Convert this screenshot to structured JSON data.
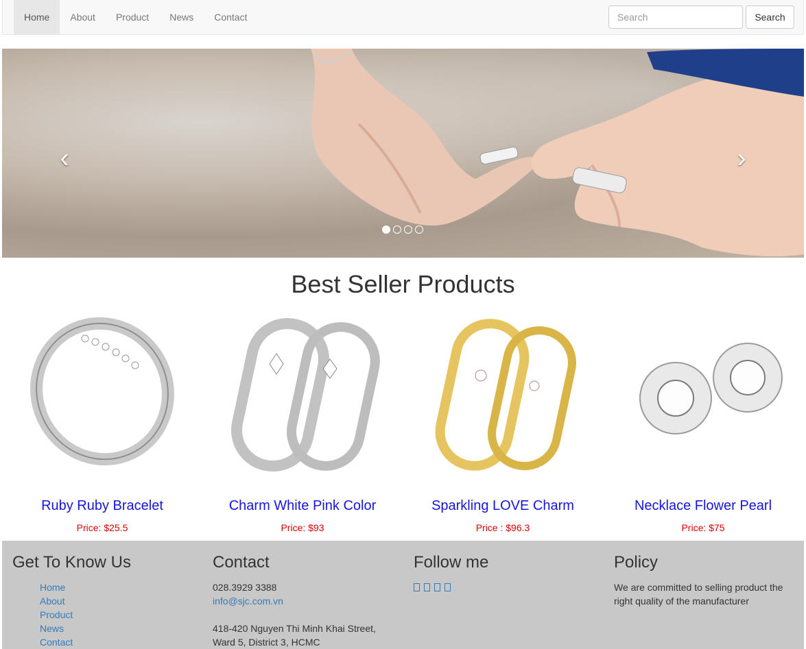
{
  "nav": {
    "items": [
      {
        "label": "Home",
        "active": true
      },
      {
        "label": "About",
        "active": false
      },
      {
        "label": "Product",
        "active": false
      },
      {
        "label": "News",
        "active": false
      },
      {
        "label": "Contact",
        "active": false
      }
    ],
    "search_placeholder": "Search",
    "search_button": "Search"
  },
  "carousel": {
    "prev_icon": "chevron-left",
    "next_icon": "chevron-right",
    "slide_count": 4,
    "active_slide": 1
  },
  "best_sellers": {
    "title": "Best Seller Products",
    "products": [
      {
        "name": "Ruby Ruby Bracelet",
        "price": "Price: $25.5"
      },
      {
        "name": "Charm White Pink Color",
        "price": "Price: $93"
      },
      {
        "name": "Sparkling LOVE Charm",
        "price": "Price : $96.3"
      },
      {
        "name": "Necklace Flower Pearl",
        "price": "Price: $75"
      }
    ]
  },
  "footer": {
    "know_us": {
      "title": "Get To Know Us",
      "links": [
        "Home",
        "About",
        "Product",
        "News",
        "Contact"
      ]
    },
    "contact": {
      "title": "Contact",
      "phone": "028.3929 3388",
      "email": "info@sjc.com.vn",
      "address_line1": "418-420 Nguyen Thi Minh Khai Street,",
      "address_line2": "Ward 5, District 3, HCMC"
    },
    "follow": {
      "title": "Follow me",
      "icons": [
        "facebook-icon",
        "twitter-icon",
        "google-plus-icon",
        "instagram-icon"
      ]
    },
    "policy": {
      "title": "Policy",
      "text": "We are committed to selling product the right quality of the manufacturer"
    }
  }
}
